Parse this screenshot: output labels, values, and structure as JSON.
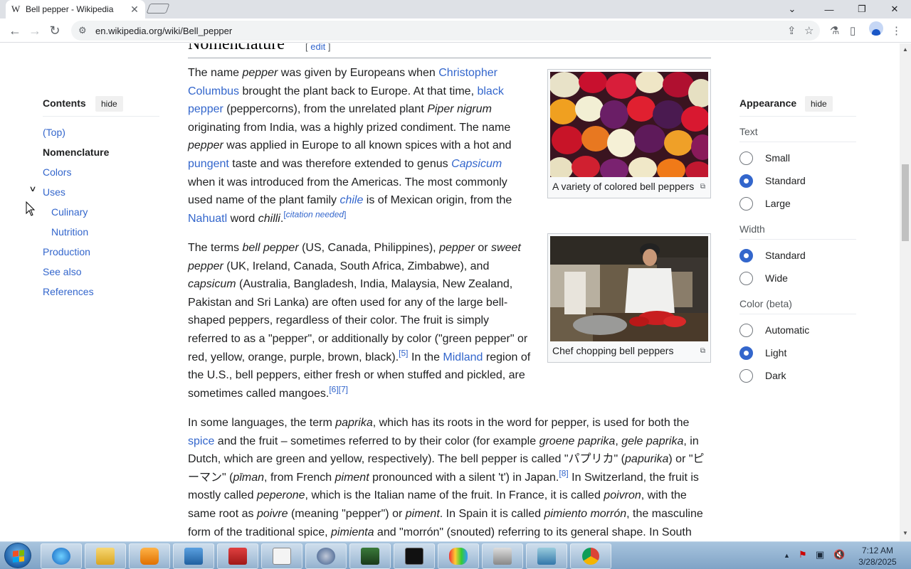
{
  "browser": {
    "tab_favicon": "W",
    "tab_title": "Bell pepper - Wikipedia",
    "tab_close": "✕",
    "url": "en.wikipedia.org/wiki/Bell_pepper",
    "icons": [
      "back-icon",
      "forward-icon",
      "reload-icon",
      "site-settings-icon",
      "share-icon",
      "bookmark-star-icon",
      "extensions-icon",
      "side-panel-icon",
      "profile-icon",
      "menu-icon"
    ]
  },
  "toc": {
    "title": "Contents",
    "hide_label": "hide",
    "items": [
      {
        "label": "(Top)"
      },
      {
        "label": "Nomenclature",
        "current": true
      },
      {
        "label": "Colors"
      },
      {
        "label": "Uses"
      },
      {
        "label": "Culinary"
      },
      {
        "label": "Nutrition"
      },
      {
        "label": "Production"
      },
      {
        "label": "See also"
      },
      {
        "label": "References"
      }
    ]
  },
  "article": {
    "heading": "Nomenclature",
    "edit_open": "[ ",
    "edit_label": "edit",
    "edit_close": " ]",
    "figures": [
      {
        "caption": "A variety of colored bell peppers"
      },
      {
        "caption": "Chef chopping bell peppers"
      }
    ]
  },
  "appearance": {
    "title": "Appearance",
    "hide_label": "hide",
    "text_label": "Text",
    "text_options": [
      "Small",
      "Standard",
      "Large"
    ],
    "text_selected": "Standard",
    "width_label": "Width",
    "width_options": [
      "Standard",
      "Wide"
    ],
    "width_selected": "Standard",
    "color_label": "Color (beta)",
    "color_options": [
      "Automatic",
      "Light",
      "Dark"
    ],
    "color_selected": "Light"
  },
  "taskbar": {
    "time": "7:12 AM",
    "date": "3/28/2025"
  }
}
